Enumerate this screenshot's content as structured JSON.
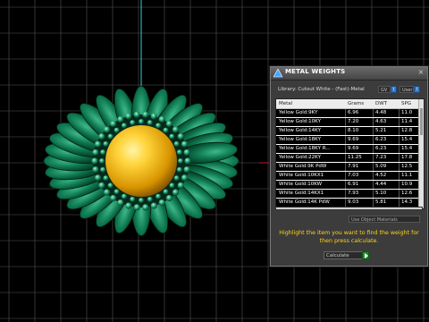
{
  "window": {
    "title": "METAL WEIGHTS",
    "close_label": "×"
  },
  "library": {
    "label": "Library: Cutout White - (Fast)-Metal",
    "gv_value": "GV",
    "user_value": "User"
  },
  "table": {
    "columns": [
      "Metal",
      "Grams",
      "DWT",
      "SPG"
    ],
    "rows": [
      {
        "metal": "Yellow Gold:9KY",
        "grams": "6.96",
        "dwt": "4.48",
        "spg": "11.0"
      },
      {
        "metal": "Yellow Gold:10KY",
        "grams": "7.20",
        "dwt": "4.63",
        "spg": "11.4"
      },
      {
        "metal": "Yellow Gold:14KY",
        "grams": "8.10",
        "dwt": "5.21",
        "spg": "12.8"
      },
      {
        "metal": "Yellow Gold:18KY",
        "grams": "9.69",
        "dwt": "6.23",
        "spg": "15.4"
      },
      {
        "metal": "Yellow Gold:18KY R...",
        "grams": "9.69",
        "dwt": "6.23",
        "spg": "15.4"
      },
      {
        "metal": "Yellow Gold:22KY",
        "grams": "11.25",
        "dwt": "7.23",
        "spg": "17.8"
      },
      {
        "metal": "White Gold:9K PdW",
        "grams": "7.91",
        "dwt": "5.09",
        "spg": "12.5"
      },
      {
        "metal": "White Gold:10KX1",
        "grams": "7.03",
        "dwt": "4.52",
        "spg": "11.1"
      },
      {
        "metal": "White Gold:10KW",
        "grams": "6.91",
        "dwt": "4.44",
        "spg": "10.9"
      },
      {
        "metal": "White Gold:14KX1",
        "grams": "7.93",
        "dwt": "5.10",
        "spg": "12.6"
      },
      {
        "metal": "White Gold:14K PdW",
        "grams": "9.03",
        "dwt": "5.81",
        "spg": "14.3"
      }
    ]
  },
  "use_object_materials_label": "Use Object Materials",
  "hint_text": "Highlight the item you want to find the weight for then press calculate.",
  "calculate_label": "Calculate",
  "colors": {
    "hint": "#ffd21a",
    "gem_green": "#0f6b4a",
    "center_gold": "#e8a400",
    "grid": "#555555"
  }
}
